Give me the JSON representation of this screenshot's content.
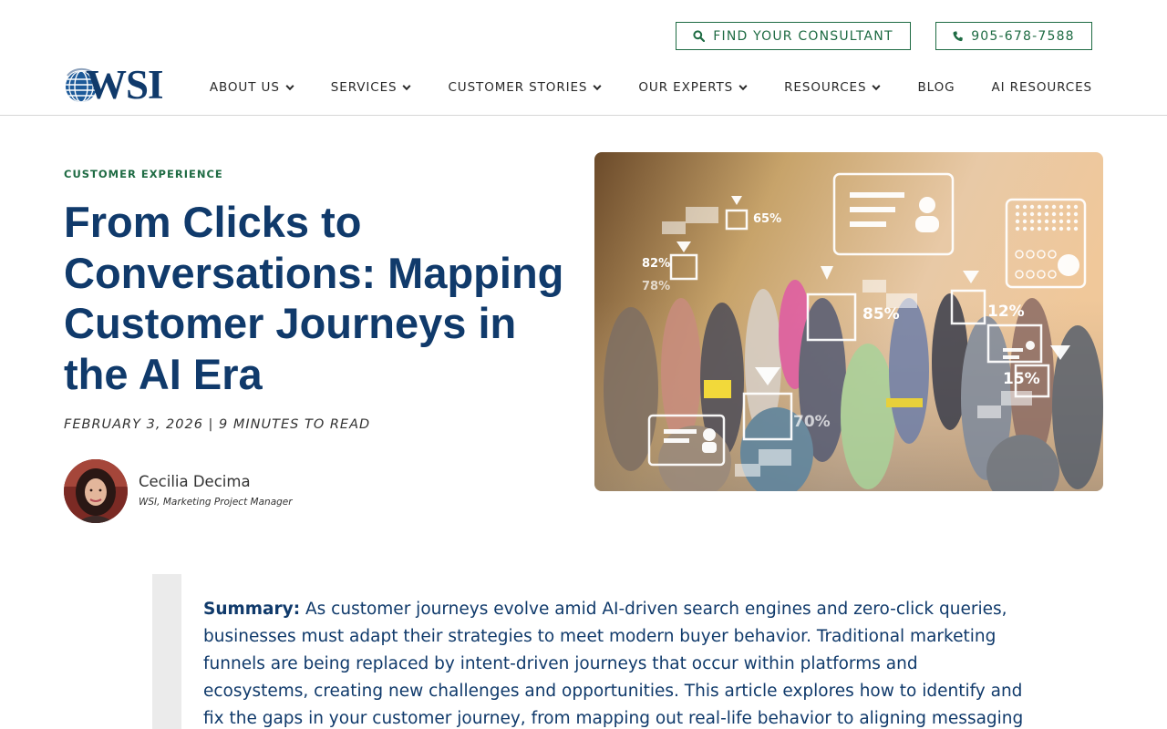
{
  "header": {
    "consultant_button": "FIND YOUR CONSULTANT",
    "phone_button": "905-678-7588",
    "logo_text": "WSI",
    "nav": [
      {
        "label": "ABOUT US",
        "dropdown": true
      },
      {
        "label": "SERVICES",
        "dropdown": true
      },
      {
        "label": "CUSTOMER STORIES",
        "dropdown": true
      },
      {
        "label": "OUR EXPERTS",
        "dropdown": true
      },
      {
        "label": "RESOURCES",
        "dropdown": true
      },
      {
        "label": "BLOG",
        "dropdown": false
      },
      {
        "label": "AI RESOURCES",
        "dropdown": false
      }
    ]
  },
  "article": {
    "category": "CUSTOMER EXPERIENCE",
    "title": "From Clicks to Conversations: Mapping Customer Journeys in the AI Era",
    "meta": "FEBRUARY 3, 2026 | 9 MINUTES TO READ",
    "author": {
      "name": "Cecilia Decima",
      "role": "WSI, Marketing Project Manager"
    },
    "hero_overlay": {
      "percentages": [
        "65%",
        "82%",
        "78%",
        "85%",
        "12%",
        "15%",
        "70%"
      ]
    },
    "summary_label": "Summary:",
    "summary_text": " As customer journeys evolve amid AI-driven search engines and zero-click queries, businesses must adapt their strategies to meet modern buyer behavior. Traditional marketing funnels are being replaced by intent-driven journeys that occur within platforms and ecosystems, creating new challenges and opportunities. This article explores how to identify and fix the gaps in your customer journey, from mapping out real-life behavior to aligning messaging with actionable data. By creating"
  },
  "colors": {
    "brand_green": "#1e6b43",
    "brand_navy": "#103a6b"
  },
  "icons": {
    "consultant": "search-icon",
    "phone": "phone-icon",
    "nav_dropdown": "chevron-down-icon"
  }
}
